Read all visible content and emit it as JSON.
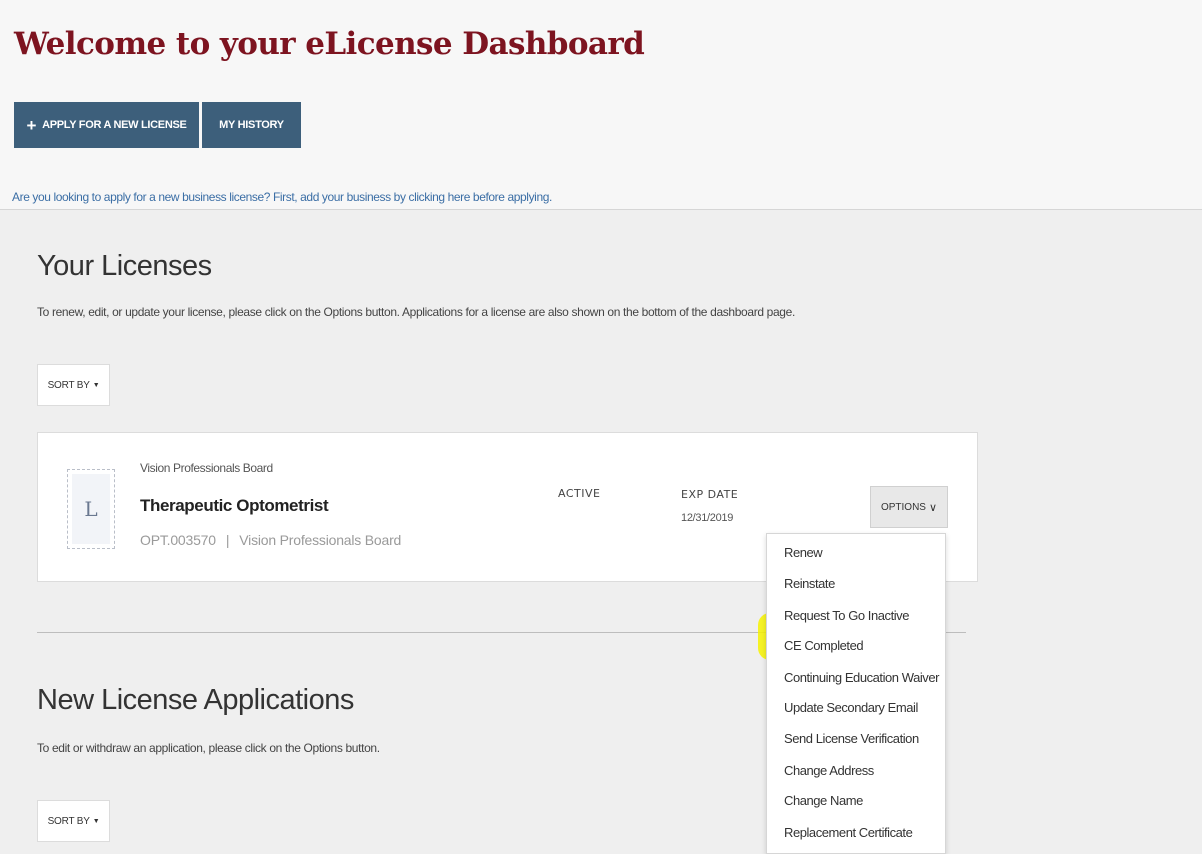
{
  "page": {
    "title": "Welcome to your eLicense Dashboard",
    "apply_button": "APPLY FOR A NEW LICENSE",
    "history_button": "MY HISTORY",
    "business_link": "Are you looking to apply for a new business license? First, add your business by clicking here before applying."
  },
  "licenses_section": {
    "title": "Your Licenses",
    "description": "To renew, edit, or update your license, please click on the Options button. Applications for a license are also shown on the bottom of the dashboard page.",
    "sort_label": "SORT BY"
  },
  "license": {
    "board": "Vision Professionals Board",
    "name": "Therapeutic Optometrist",
    "number": "OPT.003570",
    "separator": "|",
    "board_sub": "Vision Professionals Board",
    "status": "ACTIVE",
    "exp_label": "EXP DATE",
    "exp_date": "12/31/2019",
    "options_label": "OPTIONS",
    "icon_glyph": "L"
  },
  "options_menu": {
    "items": [
      "Renew",
      "Reinstate",
      "Request To Go Inactive",
      "CE Completed",
      "Continuing Education Waiver",
      "Update Secondary Email",
      "Send License Verification",
      "Change Address",
      "Change Name",
      "Replacement Certificate"
    ],
    "highlighted_item": "CE Completed",
    "highlight_color": "#f6f201"
  },
  "applications_section": {
    "title": "New License Applications",
    "description": "To edit or withdraw an application, please click on the Options button.",
    "sort_label": "SORT BY"
  },
  "icons": {
    "plus": "+",
    "caret": "▼",
    "chevron": "∨"
  },
  "colors": {
    "title": "#7d1420",
    "button": "#3d5f7b",
    "link": "#3b6ea5"
  }
}
